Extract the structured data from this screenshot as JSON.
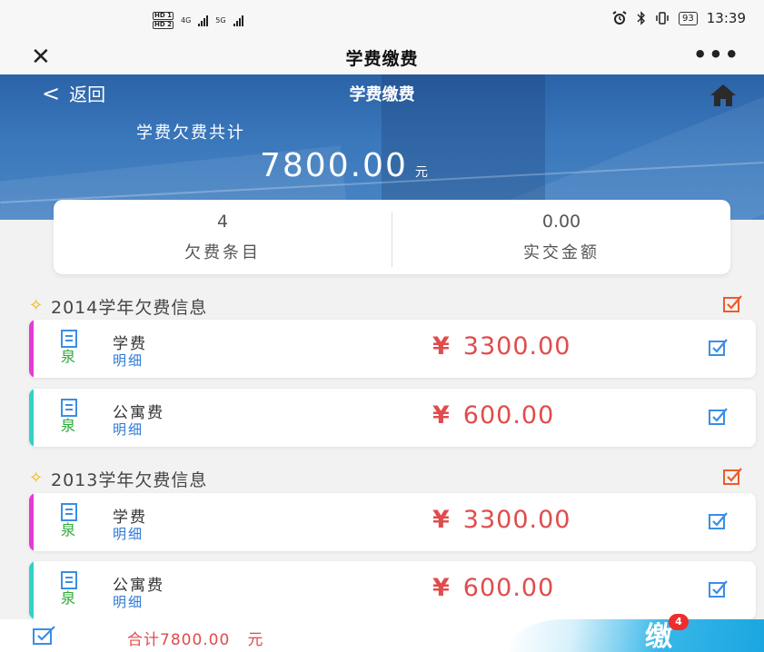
{
  "status_bar": {
    "hd_labels": [
      "HD",
      "HD"
    ],
    "sim_numbers": [
      "1",
      "2"
    ],
    "network_1": "4G",
    "network_2": "5G",
    "battery": "93",
    "time": "13:39",
    "icons": [
      "alarm-icon",
      "bluetooth-icon",
      "vibrate-icon",
      "battery-icon"
    ]
  },
  "title_bar": {
    "close_label": "✕",
    "title": "学费缴费",
    "more_label": "•••"
  },
  "banner": {
    "back_chevron": "<",
    "back_label": "返回",
    "title": "学费缴费",
    "debt_label": "学费欠费共计",
    "debt_amount": "7800.00",
    "debt_unit": "元",
    "home_icon": "home-icon"
  },
  "summary": {
    "items_count": "4",
    "items_label": "欠费条目",
    "paid_amount": "0.00",
    "paid_label": "实交金额"
  },
  "sections": [
    {
      "label": "2014学年欠费信息",
      "items": [
        {
          "name": "学费",
          "detail": "明细",
          "yen": "¥",
          "amount": "3300.00",
          "stripe_color": "#e53ad6"
        },
        {
          "name": "公寓费",
          "detail": "明细",
          "yen": "¥",
          "amount": "600.00",
          "stripe_color": "#33d1c8"
        }
      ]
    },
    {
      "label": "2013学年欠费信息",
      "items": [
        {
          "name": "学费",
          "detail": "明细",
          "yen": "¥",
          "amount": "3300.00",
          "stripe_color": "#e53ad6"
        },
        {
          "name": "公寓费",
          "detail": "明细",
          "yen": "¥",
          "amount": "600.00",
          "stripe_color": "#33d1c8"
        }
      ]
    }
  ],
  "bottom_bar": {
    "total_label": "合计7800.00",
    "total_unit": "元",
    "mascot_text": "缴",
    "badge_count": "4"
  },
  "colors": {
    "banner_blue": "#2b63a8",
    "amount_red": "#e04c4c",
    "detail_blue": "#2c7ad6",
    "check_blue": "#3a8ee6",
    "check_orange": "#ee5b2b",
    "sun_yellow": "#f0b400"
  }
}
